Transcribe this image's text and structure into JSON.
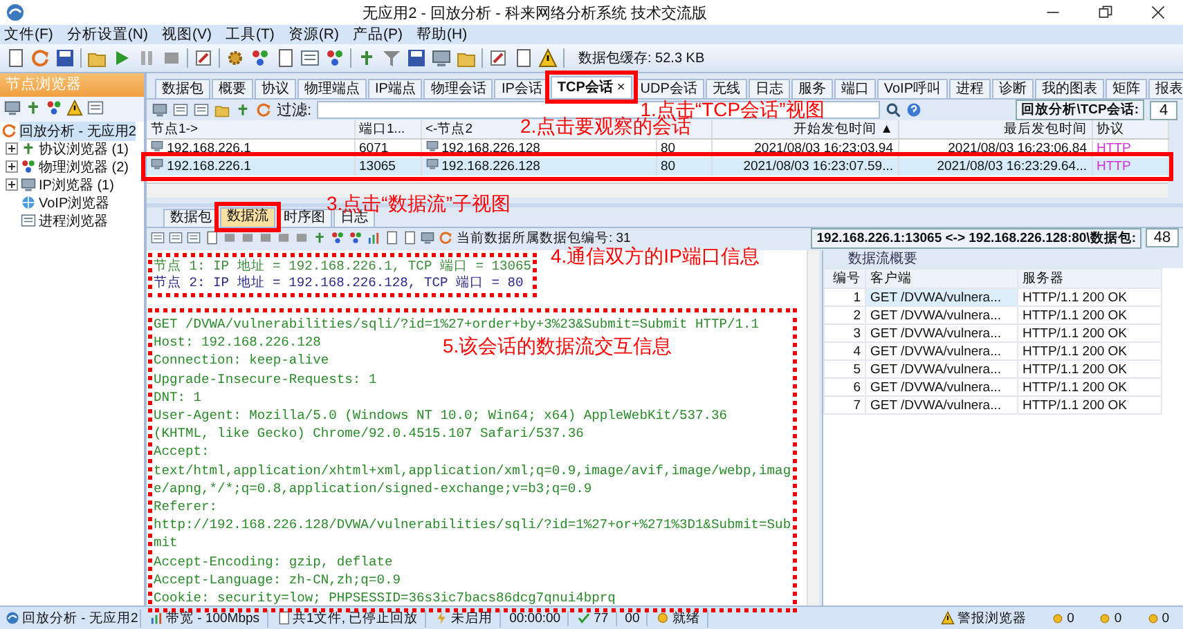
{
  "window": {
    "title": "无应用2 - 回放分析 - 科来网络分析系统 技术交流版"
  },
  "menu": [
    {
      "label": "文件(F)"
    },
    {
      "label": "分析设置(N)"
    },
    {
      "label": "视图(V)"
    },
    {
      "label": "工具(T)"
    },
    {
      "label": "资源(R)"
    },
    {
      "label": "产品(P)"
    },
    {
      "label": "帮助(H)"
    }
  ],
  "toolbar": {
    "buffer": "数据包缓存: 52.3 KB"
  },
  "node_browser": {
    "title": "节点浏览器",
    "tree": [
      {
        "label": "回放分析 - 无应用2",
        "selected": true,
        "children": [
          {
            "label": "协议浏览器 (1)",
            "expanded": false
          },
          {
            "label": "物理浏览器 (2)",
            "expanded": false
          },
          {
            "label": "IP浏览器 (1)",
            "expanded": false
          },
          {
            "label": "VoIP浏览器"
          },
          {
            "label": "进程浏览器"
          }
        ]
      }
    ]
  },
  "main_tabs": [
    {
      "label": "数据包",
      "selected": false
    },
    {
      "label": "概要",
      "selected": false
    },
    {
      "label": "协议",
      "selected": false
    },
    {
      "label": "物理端点",
      "selected": false
    },
    {
      "label": "IP端点",
      "selected": false
    },
    {
      "label": "物理会话",
      "selected": false
    },
    {
      "label": "IP会话",
      "selected": false
    },
    {
      "label": "TCP会话",
      "selected": true,
      "close": "×"
    },
    {
      "label": "UDP会话",
      "selected": false
    },
    {
      "label": "无线",
      "selected": false
    },
    {
      "label": "日志",
      "selected": false
    },
    {
      "label": "服务",
      "selected": false
    },
    {
      "label": "端口",
      "selected": false
    },
    {
      "label": "VoIP呼叫",
      "selected": false
    },
    {
      "label": "进程",
      "selected": false
    },
    {
      "label": "诊断",
      "selected": false
    },
    {
      "label": "我的图表",
      "selected": false
    },
    {
      "label": "矩阵",
      "selected": false
    },
    {
      "label": "报表",
      "selected": false
    }
  ],
  "session_toolbar": {
    "filter_label": "过滤:",
    "path_label": "回放分析\\TCP会话:",
    "count": "4"
  },
  "session_table": {
    "columns": [
      "节点1->",
      "端口1...",
      "<-节点2",
      "",
      "开始发包时间 ▲",
      "最后发包时间",
      "协议"
    ],
    "rows": [
      {
        "cells": [
          "192.168.226.1",
          "6071",
          "192.168.226.128",
          "80",
          "2021/08/03 16:23:03.94",
          "2021/08/03 16:23:06.84",
          "HTTP"
        ],
        "selected": false
      },
      {
        "cells": [
          "192.168.226.1",
          "13065",
          "192.168.226.128",
          "80",
          "2021/08/03 16:23:07.59...",
          "2021/08/03 16:23:29.64...",
          "HTTP"
        ],
        "selected": true
      }
    ]
  },
  "lower_tabs": [
    {
      "label": "数据包",
      "selected": false
    },
    {
      "label": "数据流",
      "selected": true
    },
    {
      "label": "时序图",
      "selected": false
    },
    {
      "label": "日志",
      "selected": false
    }
  ],
  "stream_toolbar": {
    "packet_label": "当前数据所属数据包编号: 31",
    "session_label": "192.168.226.1:13065 <-> 192.168.226.128:80\\数据包:",
    "packet_count": "48"
  },
  "stream": {
    "nodes": [
      {
        "text": "节点 1: IP 地址 = 192.168.226.1, TCP 端口 = 13065",
        "color": "#3a8a3a"
      },
      {
        "text": "节点 2: IP 地址 = 192.168.226.128, TCP 端口 = 80",
        "color": "#2a2a8a"
      }
    ],
    "lines": [
      "GET /DVWA/vulnerabilities/sqli/?id=1%27+order+by+3%23&Submit=Submit HTTP/1.1",
      "Host: 192.168.226.128",
      "Connection: keep-alive",
      "Upgrade-Insecure-Requests: 1",
      "DNT: 1",
      "User-Agent: Mozilla/5.0 (Windows NT 10.0; Win64; x64) AppleWebKit/537.36",
      "(KHTML, like Gecko) Chrome/92.0.4515.107 Safari/537.36",
      "Accept:",
      "text/html,application/xhtml+xml,application/xml;q=0.9,image/avif,image/webp,image/apng,*/*;q=0.8,application/signed-exchange;v=b3;q=0.9",
      "Referer:",
      "http://192.168.226.128/DVWA/vulnerabilities/sqli/?id=1%27+or+%271%3D1&Submit=Submit",
      "Accept-Encoding: gzip, deflate",
      "Accept-Language: zh-CN,zh;q=0.9",
      "Cookie: security=low; PHPSESSID=36s3ic7bacs86dcg7qnui4bprq"
    ]
  },
  "summary": {
    "title": "数据流概要",
    "columns": [
      "编号",
      "客户端",
      "服务器"
    ],
    "rows": [
      {
        "cells": [
          "1",
          "GET /DVWA/vulnera...",
          "HTTP/1.1 200 OK"
        ],
        "selected": true
      },
      {
        "cells": [
          "2",
          "GET /DVWA/vulnera...",
          "HTTP/1.1 200 OK"
        ],
        "selected": false
      },
      {
        "cells": [
          "3",
          "GET /DVWA/vulnera...",
          "HTTP/1.1 200 OK"
        ],
        "selected": false
      },
      {
        "cells": [
          "4",
          "GET /DVWA/vulnera...",
          "HTTP/1.1 200 OK"
        ],
        "selected": false
      },
      {
        "cells": [
          "5",
          "GET /DVWA/vulnera...",
          "HTTP/1.1 200 OK"
        ],
        "selected": false
      },
      {
        "cells": [
          "6",
          "GET /DVWA/vulnera...",
          "HTTP/1.1 200 OK"
        ],
        "selected": false
      },
      {
        "cells": [
          "7",
          "GET /DVWA/vulnera...",
          "HTTP/1.1 200 OK"
        ],
        "selected": false
      }
    ]
  },
  "status_bar": {
    "items": [
      "回放分析 - 无应用2",
      "带宽 - 100Mbps",
      "共1文件, 已停止回放",
      "未启用",
      "00:00:00",
      "77",
      "00",
      "就绪"
    ],
    "alerts_label": "警报浏览器",
    "alert_counts": [
      "0",
      "0",
      "0"
    ]
  },
  "annotations": [
    "1.点击“TCP会话”视图",
    "2.点击要观察的会话",
    "3.点击“数据流”子视图",
    "4.通信双方的IP端口信息",
    "5.该会话的数据流交互信息"
  ]
}
